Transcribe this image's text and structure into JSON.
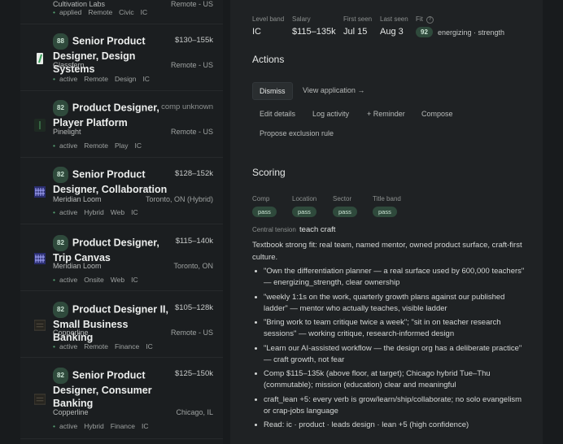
{
  "jobs": [
    {
      "company": "Cultivation Labs",
      "location": "Remote - US",
      "tags": [
        "applied",
        "Remote",
        "Civic",
        "IC"
      ]
    },
    {
      "score": "88",
      "title": "Senior Product Designer, Design Systems",
      "salary": "$130–155k",
      "company": "Glassfern",
      "location": "Remote - US",
      "tags": [
        "active",
        "Remote",
        "Design",
        "IC"
      ],
      "logo_icon": "glassfern-logo-icon"
    },
    {
      "score": "82",
      "title": "Product Designer, Player Platform",
      "salary": "comp unknown",
      "company": "Pinelight",
      "location": "Remote - US",
      "tags": [
        "active",
        "Remote",
        "Play",
        "IC"
      ],
      "logo_icon": "pinelight-logo-icon"
    },
    {
      "score": "82",
      "title": "Senior Product Designer, Collaboration",
      "salary": "$128–152k",
      "company": "Meridian Loom",
      "location": "Toronto, ON (Hybrid)",
      "tags": [
        "active",
        "Hybrid",
        "Web",
        "IC"
      ],
      "logo_icon": "meridian-loom-logo-icon"
    },
    {
      "score": "82",
      "title": "Product Designer, Trip Canvas",
      "salary": "$115–140k",
      "company": "Meridian Loom",
      "location": "Toronto, ON",
      "tags": [
        "active",
        "Onsite",
        "Web",
        "IC"
      ],
      "logo_icon": "meridian-loom-logo-icon"
    },
    {
      "score": "82",
      "title": "Product Designer II, Small Business Banking",
      "salary": "$105–128k",
      "company": "Copperline",
      "location": "Remote - US",
      "tags": [
        "active",
        "Remote",
        "Finance",
        "IC"
      ],
      "logo_icon": "copperline-logo-icon"
    },
    {
      "score": "82",
      "title": "Senior Product Designer, Consumer Banking",
      "salary": "$125–150k",
      "company": "Copperline",
      "location": "Chicago, IL",
      "tags": [
        "active",
        "Hybrid",
        "Finance",
        "IC"
      ],
      "logo_icon": "copperline-logo-icon"
    }
  ],
  "detail": {
    "meta": {
      "level_band_label": "Level band",
      "level_band": "IC",
      "salary_label": "Salary",
      "salary": "$115–135k",
      "first_seen_label": "First seen",
      "first_seen": "Jul 15",
      "last_seen_label": "Last seen",
      "last_seen": "Aug 3",
      "fit_label": "Fit",
      "fit_help": "?",
      "fit_score": "92",
      "fit_tags": "energizing · strength"
    },
    "actions": {
      "heading": "Actions",
      "dismiss": "Dismiss",
      "view_application": "View application →",
      "edit_details": "Edit details",
      "log_activity": "Log activity",
      "reminder": "+ Reminder",
      "compose": "Compose",
      "propose_exclusion": "Propose exclusion rule"
    },
    "scoring": {
      "heading": "Scoring",
      "checks": [
        {
          "label": "Comp",
          "result": "pass"
        },
        {
          "label": "Location",
          "result": "pass"
        },
        {
          "label": "Sector",
          "result": "pass"
        },
        {
          "label": "Title band",
          "result": "pass"
        }
      ],
      "tension_label": "Central tension",
      "tension_value": "teach craft",
      "summary": "Textbook strong fit: real team, named mentor, owned product surface, craft-first culture.",
      "bullets": [
        "\"Own the differentiation planner — a real surface used by 600,000 teachers\" — energizing_strength, clear ownership",
        "\"weekly 1:1s on the work, quarterly growth plans against our published ladder\" — mentor who actually teaches, visible ladder",
        "\"Bring work to team critique twice a week\"; \"sit in on teacher research sessions\" — working critique, research-informed design",
        "\"Learn our AI-assisted workflow — the design org has a deliberate practice\" — craft growth, not fear",
        "Comp $115–135k (above floor, at target); Chicago hybrid Tue–Thu (commutable); mission (education) clear and meaningful",
        "craft_lean +5: every verb is grow/learn/ship/collaborate; no solo evangelism or crap-jobs language",
        "Read: ic · product · leads design · lean +5 (high confidence)"
      ]
    }
  }
}
